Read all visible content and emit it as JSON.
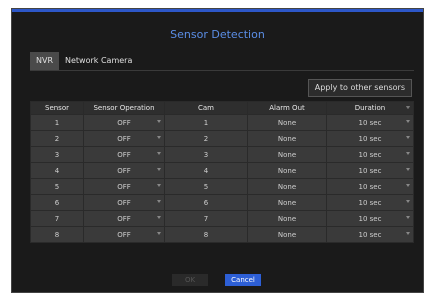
{
  "dialog": {
    "title": "Sensor Detection"
  },
  "tabs": [
    "NVR",
    "Network Camera"
  ],
  "apply_label": "Apply to other sensors",
  "columns": [
    "Sensor",
    "Sensor Operation",
    "Cam",
    "Alarm Out",
    "Duration"
  ],
  "rows": [
    [
      "1",
      "OFF",
      "1",
      "None",
      "10 sec"
    ],
    [
      "2",
      "OFF",
      "2",
      "None",
      "10 sec"
    ],
    [
      "3",
      "OFF",
      "3",
      "None",
      "10 sec"
    ],
    [
      "4",
      "OFF",
      "4",
      "None",
      "10 sec"
    ],
    [
      "5",
      "OFF",
      "5",
      "None",
      "10 sec"
    ],
    [
      "6",
      "OFF",
      "6",
      "None",
      "10 sec"
    ],
    [
      "7",
      "OFF",
      "7",
      "None",
      "10 sec"
    ],
    [
      "8",
      "OFF",
      "8",
      "None",
      "10 sec"
    ]
  ],
  "buttons": {
    "ok": "OK",
    "cancel": "Cancel"
  },
  "colors": {
    "accent": "#2d5fd6",
    "title": "#5b8ee6",
    "background": "#1a1a1a"
  },
  "icons": {
    "dropdown": "chevron-down-icon"
  }
}
